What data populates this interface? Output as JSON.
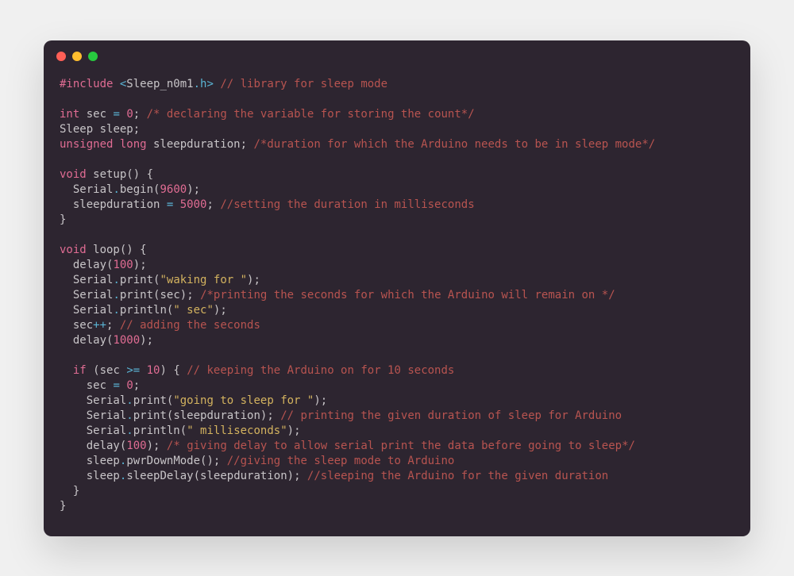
{
  "titlebar": {
    "buttons": [
      "close",
      "minimize",
      "maximize"
    ]
  },
  "code": {
    "l1_include": "#include",
    "l1_open": " <",
    "l1_lib": "Sleep_n0m1",
    "l1_doth": ".h",
    "l1_close": ">",
    "l1_comment": " // library for sleep mode",
    "l3_type": "int",
    "l3_ident": " sec ",
    "l3_assign": "=",
    "l3_space": " ",
    "l3_val": "0",
    "l3_semi": ";",
    "l3_comment": " /* declaring the variable for storing the count*/",
    "l4_type": "Sleep",
    "l4_ident": " sleep",
    "l4_semi": ";",
    "l5_type": "unsigned long",
    "l5_ident": " sleepduration",
    "l5_semi": ";",
    "l5_comment": " /*duration for which the Arduino needs to be in sleep mode*/",
    "l7_type": "void",
    "l7_fn": " setup",
    "l7_paren": "()",
    "l7_brace": " {",
    "l8_indent": "  ",
    "l8_obj": "Serial",
    "l8_dot": ".",
    "l8_method": "begin",
    "l8_open": "(",
    "l8_arg": "9600",
    "l8_close": ")",
    "l8_semi": ";",
    "l9_indent": "  ",
    "l9_ident": "sleepduration ",
    "l9_assign": "=",
    "l9_space": " ",
    "l9_val": "5000",
    "l9_semi": ";",
    "l9_comment": " //setting the duration in milliseconds",
    "l10_brace": "}",
    "l12_type": "void",
    "l12_fn": " loop",
    "l12_paren": "()",
    "l12_brace": " {",
    "l13_indent": "  ",
    "l13_fn": "delay",
    "l13_open": "(",
    "l13_arg": "100",
    "l13_close": ")",
    "l13_semi": ";",
    "l14_indent": "  ",
    "l14_obj": "Serial",
    "l14_dot": ".",
    "l14_method": "print",
    "l14_open": "(",
    "l14_str": "\"waking for \"",
    "l14_close": ")",
    "l14_semi": ";",
    "l15_indent": "  ",
    "l15_obj": "Serial",
    "l15_dot": ".",
    "l15_method": "print",
    "l15_open": "(",
    "l15_arg": "sec",
    "l15_close": ")",
    "l15_semi": ";",
    "l15_comment": " /*printing the seconds for which the Arduino will remain on */",
    "l16_indent": "  ",
    "l16_obj": "Serial",
    "l16_dot": ".",
    "l16_method": "println",
    "l16_open": "(",
    "l16_str": "\" sec\"",
    "l16_close": ")",
    "l16_semi": ";",
    "l17_indent": "  ",
    "l17_ident": "sec",
    "l17_op": "++",
    "l17_semi": ";",
    "l17_comment": " // adding the seconds",
    "l18_indent": "  ",
    "l18_fn": "delay",
    "l18_open": "(",
    "l18_arg": "1000",
    "l18_close": ")",
    "l18_semi": ";",
    "l20_indent": "  ",
    "l20_if": "if",
    "l20_space": " ",
    "l20_open": "(",
    "l20_ident": "sec ",
    "l20_op": ">=",
    "l20_space2": " ",
    "l20_val": "10",
    "l20_close": ")",
    "l20_brace": " {",
    "l20_comment": " // keeping the Arduino on for 10 seconds",
    "l21_indent": "    ",
    "l21_ident": "sec ",
    "l21_assign": "=",
    "l21_space": " ",
    "l21_val": "0",
    "l21_semi": ";",
    "l22_indent": "    ",
    "l22_obj": "Serial",
    "l22_dot": ".",
    "l22_method": "print",
    "l22_open": "(",
    "l22_str": "\"going to sleep for \"",
    "l22_close": ")",
    "l22_semi": ";",
    "l23_indent": "    ",
    "l23_obj": "Serial",
    "l23_dot": ".",
    "l23_method": "print",
    "l23_open": "(",
    "l23_arg": "sleepduration",
    "l23_close": ")",
    "l23_semi": ";",
    "l23_comment": " // printing the given duration of sleep for Arduino",
    "l24_indent": "    ",
    "l24_obj": "Serial",
    "l24_dot": ".",
    "l24_method": "println",
    "l24_open": "(",
    "l24_str": "\" milliseconds\"",
    "l24_close": ")",
    "l24_semi": ";",
    "l25_indent": "    ",
    "l25_fn": "delay",
    "l25_open": "(",
    "l25_arg": "100",
    "l25_close": ")",
    "l25_semi": ";",
    "l25_comment": " /* giving delay to allow serial print the data before going to sleep*/",
    "l26_indent": "    ",
    "l26_obj": "sleep",
    "l26_dot": ".",
    "l26_method": "pwrDownMode",
    "l26_paren": "()",
    "l26_semi": ";",
    "l26_comment": " //giving the sleep mode to Arduino",
    "l27_indent": "    ",
    "l27_obj": "sleep",
    "l27_dot": ".",
    "l27_method": "sleepDelay",
    "l27_open": "(",
    "l27_arg": "sleepduration",
    "l27_close": ")",
    "l27_semi": ";",
    "l27_comment": " //sleeping the Arduino for the given duration",
    "l28_indent": "  ",
    "l28_brace": "}",
    "l29_brace": "}"
  }
}
